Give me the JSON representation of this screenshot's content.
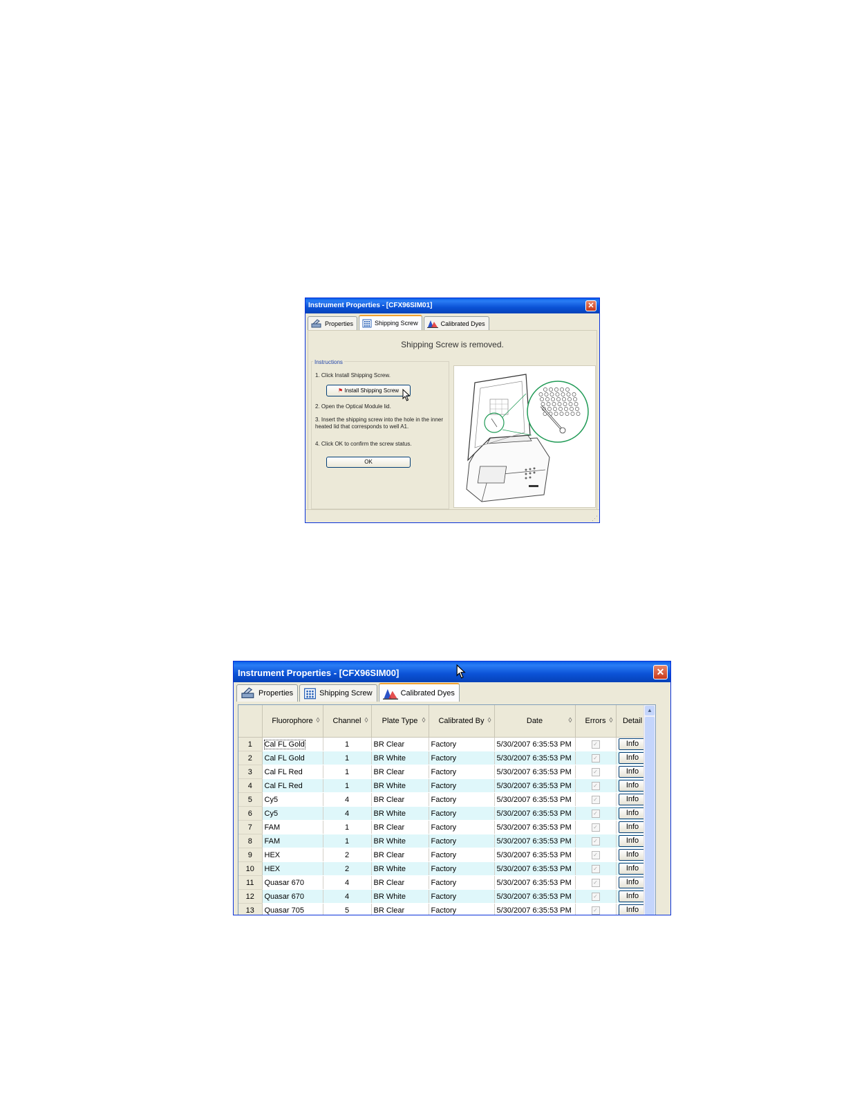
{
  "window1": {
    "title": "Instrument Properties - [CFX96SIM01]",
    "tabs": [
      {
        "label": "Properties",
        "icon": "properties-icon"
      },
      {
        "label": "Shipping Screw",
        "icon": "plate-icon"
      },
      {
        "label": "Calibrated Dyes",
        "icon": "dye-chart-icon"
      }
    ],
    "active_tab": "Shipping Screw",
    "status": "Shipping Screw is removed.",
    "instructions_label": "Instructions",
    "steps": [
      "1. Click Install Shipping Screw.",
      "2. Open the Optical Module lid.",
      "3. Insert the shipping screw into the hole in the inner heated lid that corresponds to well A1.",
      "4. Click OK to confirm the screw status."
    ],
    "install_button": "Install Shipping Screw",
    "ok_button": "OK"
  },
  "window2": {
    "title": "Instrument Properties - [CFX96SIM00]",
    "tabs": [
      {
        "label": "Properties",
        "icon": "properties-icon"
      },
      {
        "label": "Shipping Screw",
        "icon": "plate-icon"
      },
      {
        "label": "Calibrated Dyes",
        "icon": "dye-chart-icon"
      }
    ],
    "active_tab": "Calibrated Dyes",
    "columns": [
      "Fluorophore",
      "Channel",
      "Plate Type",
      "Calibrated By",
      "Date",
      "Errors",
      "Detail"
    ],
    "info_label": "Info",
    "rows": [
      {
        "n": "1",
        "fluorophore": "Cal FL Gold",
        "channel": "1",
        "plate": "BR Clear",
        "by": "Factory",
        "date": "5/30/2007 6:35:53 PM"
      },
      {
        "n": "2",
        "fluorophore": "Cal FL Gold",
        "channel": "1",
        "plate": "BR White",
        "by": "Factory",
        "date": "5/30/2007 6:35:53 PM"
      },
      {
        "n": "3",
        "fluorophore": "Cal FL Red",
        "channel": "1",
        "plate": "BR Clear",
        "by": "Factory",
        "date": "5/30/2007 6:35:53 PM"
      },
      {
        "n": "4",
        "fluorophore": "Cal FL Red",
        "channel": "1",
        "plate": "BR White",
        "by": "Factory",
        "date": "5/30/2007 6:35:53 PM"
      },
      {
        "n": "5",
        "fluorophore": "Cy5",
        "channel": "4",
        "plate": "BR Clear",
        "by": "Factory",
        "date": "5/30/2007 6:35:53 PM"
      },
      {
        "n": "6",
        "fluorophore": "Cy5",
        "channel": "4",
        "plate": "BR White",
        "by": "Factory",
        "date": "5/30/2007 6:35:53 PM"
      },
      {
        "n": "7",
        "fluorophore": "FAM",
        "channel": "1",
        "plate": "BR Clear",
        "by": "Factory",
        "date": "5/30/2007 6:35:53 PM"
      },
      {
        "n": "8",
        "fluorophore": "FAM",
        "channel": "1",
        "plate": "BR White",
        "by": "Factory",
        "date": "5/30/2007 6:35:53 PM"
      },
      {
        "n": "9",
        "fluorophore": "HEX",
        "channel": "2",
        "plate": "BR Clear",
        "by": "Factory",
        "date": "5/30/2007 6:35:53 PM"
      },
      {
        "n": "10",
        "fluorophore": "HEX",
        "channel": "2",
        "plate": "BR White",
        "by": "Factory",
        "date": "5/30/2007 6:35:53 PM"
      },
      {
        "n": "11",
        "fluorophore": "Quasar 670",
        "channel": "4",
        "plate": "BR Clear",
        "by": "Factory",
        "date": "5/30/2007 6:35:53 PM"
      },
      {
        "n": "12",
        "fluorophore": "Quasar 670",
        "channel": "4",
        "plate": "BR White",
        "by": "Factory",
        "date": "5/30/2007 6:35:53 PM"
      },
      {
        "n": "13",
        "fluorophore": "Quasar 705",
        "channel": "5",
        "plate": "BR Clear",
        "by": "Factory",
        "date": "5/30/2007 6:35:53 PM"
      }
    ]
  },
  "colors": {
    "titlebar": "#0b52d6",
    "window_bg": "#ece9d8",
    "row_alt": "#dff7fa",
    "active_tab_accent": "#f0a030",
    "close_button": "#c8391a"
  }
}
